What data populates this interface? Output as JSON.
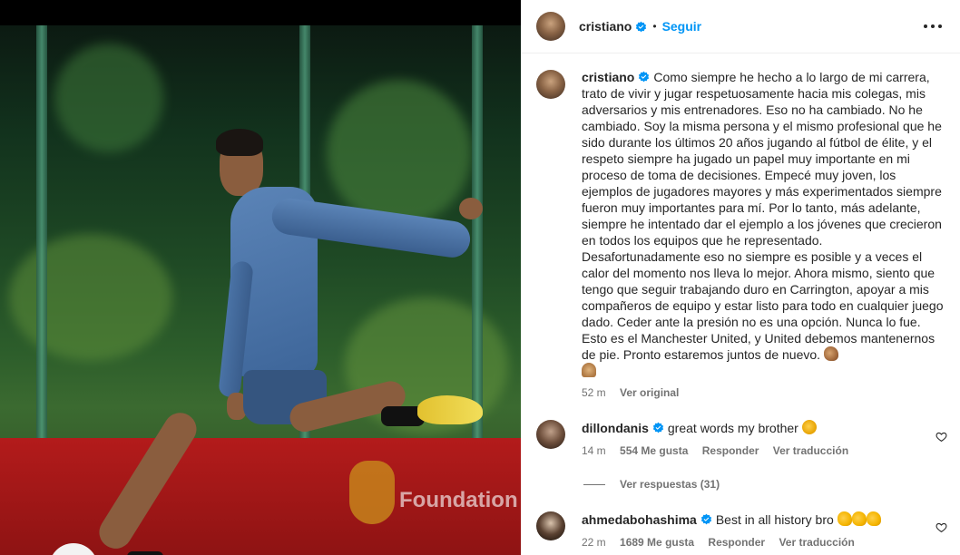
{
  "post": {
    "username": "cristiano",
    "follow_label": "Seguir",
    "dot": "•"
  },
  "caption": {
    "username": "cristiano",
    "text": "Como siempre he hecho a lo largo de mi carrera, trato de vivir y jugar respetuosamente hacia mis colegas, mis adversarios y mis entrenadores. Eso no ha cambiado. No he cambiado. Soy la misma persona y el mismo profesional que he sido durante los últimos 20 años jugando al fútbol de élite, y el respeto siempre ha jugado un papel muy importante en mi proceso de toma de decisiones. Empecé muy joven, los ejemplos de jugadores mayores y más experimentados siempre fueron muy importantes para mí. Por lo tanto, más adelante, siempre he intentado dar el ejemplo a los jóvenes que crecieron en todos los equipos que he representado. Desafortunadamente eso no siempre es posible y a veces el calor del momento nos lleva lo mejor. Ahora mismo, siento que tengo que seguir trabajando duro en Carrington, apoyar a mis compañeros de equipo y estar listo para todo en cualquier juego dado. Ceder ante la presión no es una opción. Nunca lo fue. Esto es el Manchester United, y United debemos mantenernos de pie. Pronto estaremos juntos de nuevo.",
    "time": "52 m",
    "see_original": "Ver original"
  },
  "comments": [
    {
      "username": "dillondanis",
      "text": "great words my brother",
      "time": "14 m",
      "likes": "554 Me gusta",
      "reply": "Responder",
      "translate": "Ver traducción"
    },
    {
      "username": "ahmedabohashima",
      "text": "Best in all history bro",
      "time": "22 m",
      "likes": "1689 Me gusta",
      "reply": "Responder",
      "translate": "Ver traducción"
    }
  ],
  "view_replies": "Ver respuestas (31)",
  "photo": {
    "banner_text": "Foundation"
  },
  "colors": {
    "follow": "#0095f6",
    "verified": "#0095f6",
    "muted": "#737373"
  }
}
